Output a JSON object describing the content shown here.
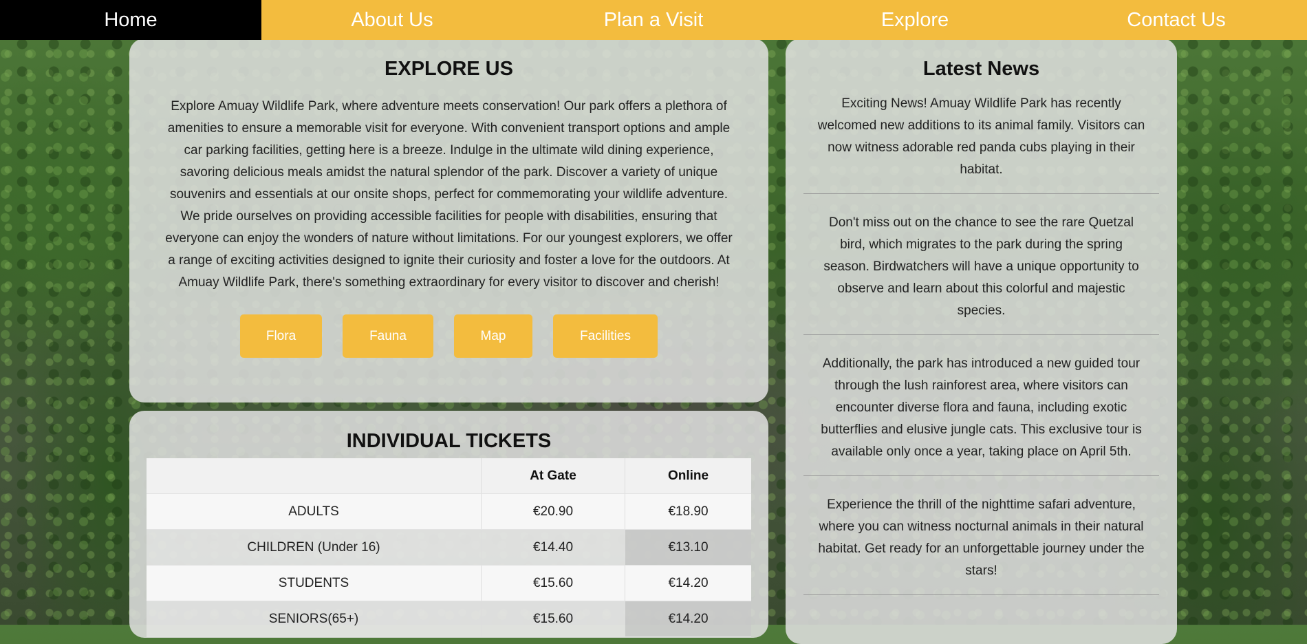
{
  "nav": {
    "items": [
      {
        "label": "Home",
        "active": true
      },
      {
        "label": "About Us",
        "active": false
      },
      {
        "label": "Plan a Visit",
        "active": false
      },
      {
        "label": "Explore",
        "active": false
      },
      {
        "label": "Contact Us",
        "active": false
      }
    ]
  },
  "explore": {
    "title": "EXPLORE US",
    "text": "Explore Amuay Wildlife Park, where adventure meets conservation! Our park offers a plethora of amenities to ensure a memorable visit for everyone. With convenient transport options and ample car parking facilities, getting here is a breeze. Indulge in the ultimate wild dining experience, savoring delicious meals amidst the natural splendor of the park. Discover a variety of unique souvenirs and essentials at our onsite shops, perfect for commemorating your wildlife adventure. We pride ourselves on providing accessible facilities for people with disabilities, ensuring that everyone can enjoy the wonders of nature without limitations. For our youngest explorers, we offer a range of exciting activities designed to ignite their curiosity and foster a love for the outdoors. At Amuay Wildlife Park, there's something extraordinary for every visitor to discover and cherish!",
    "buttons": [
      "Flora",
      "Fauna",
      "Map",
      "Facilities"
    ]
  },
  "tickets": {
    "title": "INDIVIDUAL TICKETS",
    "headers": [
      "",
      "At Gate",
      "Online"
    ],
    "rows": [
      {
        "type": "ADULTS",
        "gate": "€20.90",
        "online": "€18.90"
      },
      {
        "type": "CHILDREN (Under 16)",
        "gate": "€14.40",
        "online": "€13.10"
      },
      {
        "type": "STUDENTS",
        "gate": "€15.60",
        "online": "€14.20"
      },
      {
        "type": "SENIORS(65+)",
        "gate": "€15.60",
        "online": "€14.20"
      }
    ]
  },
  "news": {
    "title": "Latest News",
    "items": [
      "Exciting News! Amuay Wildlife Park has recently welcomed new additions to its animal family. Visitors can now witness adorable red panda cubs playing in their habitat.",
      "Don't miss out on the chance to see the rare Quetzal bird, which migrates to the park during the spring season. Birdwatchers will have a unique opportunity to observe and learn about this colorful and majestic species.",
      "Additionally, the park has introduced a new guided tour through the lush rainforest area, where visitors can encounter diverse flora and fauna, including exotic butterflies and elusive jungle cats. This exclusive tour is available only once a year, taking place on April 5th.",
      "Experience the thrill of the nighttime safari adventure, where you can witness nocturnal animals in their natural habitat. Get ready for an unforgettable journey under the stars!"
    ]
  },
  "colors": {
    "accent": "#f3bc3e",
    "nav_active": "#000000"
  }
}
